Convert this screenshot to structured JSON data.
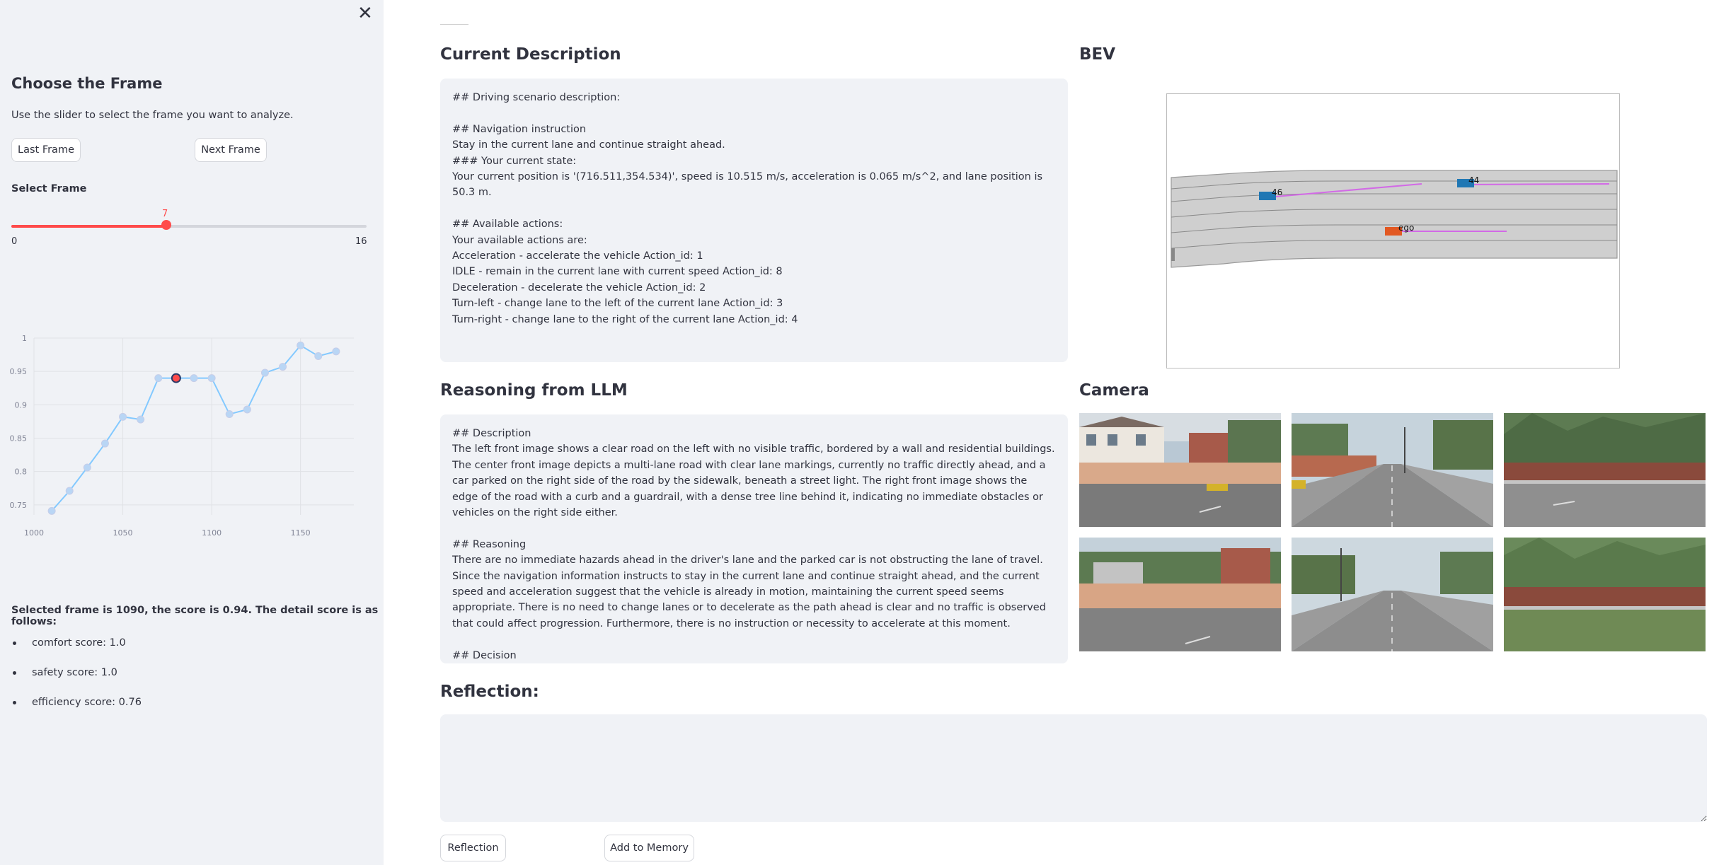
{
  "sidebar": {
    "close_icon": "close-icon",
    "title": "Choose the Frame",
    "description": "Use the slider to select the frame you want to analyze.",
    "last_frame_label": "Last Frame",
    "next_frame_label": "Next Frame",
    "select_label": "Select Frame",
    "slider": {
      "value": "7",
      "min": "0",
      "max": "16"
    },
    "selected_text": "Selected frame is 1090, the score is 0.94. The detail score is as follows:",
    "scores": [
      {
        "label": "comfort score: 1.0"
      },
      {
        "label": "safety score: 1.0"
      },
      {
        "label": "efficiency score: 0.76"
      }
    ]
  },
  "chart_data": {
    "type": "line",
    "x": [
      1010,
      1020,
      1030,
      1040,
      1050,
      1060,
      1070,
      1080,
      1090,
      1100,
      1110,
      1120,
      1130,
      1140,
      1150,
      1160,
      1170
    ],
    "y": [
      0.741,
      0.771,
      0.806,
      0.842,
      0.882,
      0.878,
      0.94,
      0.94,
      0.94,
      0.94,
      0.886,
      0.893,
      0.948,
      0.957,
      0.989,
      0.973,
      0.98
    ],
    "highlight_x": 1080,
    "xticks": [
      "1000",
      "1050",
      "1100",
      "1150"
    ],
    "yticks": [
      "0.75",
      "0.8",
      "0.85",
      "0.9",
      "0.95",
      "1"
    ],
    "xlim": [
      1000,
      1180
    ],
    "ylim": [
      0.735,
      1.0
    ],
    "grid": true,
    "line_color": "#83c9ff"
  },
  "main": {
    "current_title": "Current Description",
    "current_text": "## Driving scenario description:\n\n## Navigation instruction\nStay in the current lane and continue straight ahead.\n### Your current state:\nYour current position is '(716.511,354.534)', speed is 10.515 m/s, acceleration is 0.065 m/s^2, and lane position is 50.3 m.\n\n## Available actions:\nYour available actions are:\nAcceleration - accelerate the vehicle Action_id: 1\nIDLE - remain in the current lane with current speed Action_id: 8\nDeceleration - decelerate the vehicle Action_id: 2\nTurn-left - change lane to the left of the current lane Action_id: 3\nTurn-right - change lane to the right of the current lane Action_id: 4",
    "bev_title": "BEV",
    "bev_labels": {
      "car1": "46",
      "car2": "44",
      "ego": "ego"
    },
    "reasoning_title": "Reasoning from LLM",
    "reasoning_text": "## Description\nThe left front image shows a clear road on the left with no visible traffic, bordered by a wall and residential buildings. The center front image depicts a multi-lane road with clear lane markings, currently no traffic directly ahead, and a car parked on the right side of the road by the sidewalk, beneath a street light. The right front image shows the edge of the road with a curb and a guardrail, with a dense tree line behind it, indicating no immediate obstacles or vehicles on the right side either.\n\n## Reasoning\nThere are no immediate hazards ahead in the driver's lane and the parked car is not obstructing the lane of travel. Since the navigation information instructs to stay in the current lane and continue straight ahead, and the current speed and acceleration suggest that the vehicle is already in motion, maintaining the current speed seems appropriate. There is no need to change lanes or to decelerate as the path ahead is clear and no traffic is observed that could affect progression. Furthermore, there is no instruction or necessity to accelerate at this moment.\n\n## Decision\nIDLE",
    "camera_title": "Camera",
    "reflection_title": "Reflection:",
    "reflection_value": "",
    "reflection_button": "Reflection",
    "memory_button": "Add to Memory"
  },
  "colors": {
    "accent": "#ff4b4b",
    "panel": "#f0f2f6",
    "ego": "#e25822",
    "vehicle": "#1f77b4",
    "trajectory": "#d26ae6"
  }
}
